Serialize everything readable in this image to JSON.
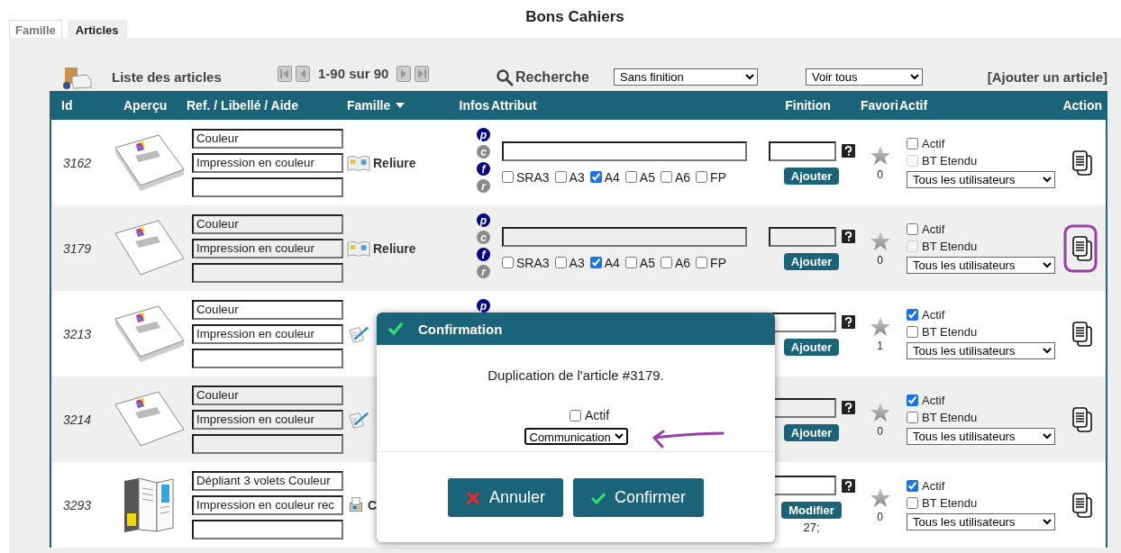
{
  "page_title": "Bons Cahiers",
  "tabs": [
    {
      "label": "Famille",
      "selected": false
    },
    {
      "label": "Articles",
      "selected": true
    }
  ],
  "toolbar": {
    "title": "Liste des articles",
    "pager": "1-90 sur 90",
    "search_label": "Recherche",
    "finition_filter": "Sans finition",
    "view_filter": "Voir tous",
    "add_link": "[Ajouter un article]"
  },
  "table": {
    "columns": [
      {
        "label": "Id",
        "sorted": false
      },
      {
        "label": "Aperçu",
        "sorted": false
      },
      {
        "label": "Ref. / Libellé / Aide",
        "sorted": false
      },
      {
        "label": "Famille",
        "sorted": true
      },
      {
        "label": "Infos",
        "sorted": false
      },
      {
        "label": "Attribut",
        "sorted": false
      },
      {
        "label": "Finition",
        "sorted": false
      },
      {
        "label": "Favori",
        "sorted": false
      },
      {
        "label": "Actif",
        "sorted": false
      },
      {
        "label": "Action",
        "sorted": false
      }
    ],
    "rows": [
      {
        "id": "3162",
        "preview": {
          "kind": "booklet"
        },
        "ref": "Couleur",
        "label": "Impression en couleur",
        "family_icon": {
          "kind": "book"
        },
        "family": "Reliure",
        "infos": [
          {
            "letter": "p",
            "color": "#00008b"
          },
          {
            "letter": "c",
            "color": "#8a8a8a"
          },
          {
            "letter": "f",
            "color": "#00008b"
          },
          {
            "letter": "r",
            "color": "#8a8a8a"
          }
        ],
        "formats": [
          {
            "label": "SRA3",
            "checked": false
          },
          {
            "label": "A3",
            "checked": false
          },
          {
            "label": "A4",
            "checked": true
          },
          {
            "label": "A5",
            "checked": false
          },
          {
            "label": "A6",
            "checked": false
          },
          {
            "label": "FP",
            "checked": false
          }
        ],
        "finition_button": "Ajouter",
        "favorites": "0",
        "actif_label": "Actif",
        "actif": false,
        "bt_label": "BT Etendu",
        "bt_etendu": false,
        "bt_disabled": true,
        "users": "Tous les utilisateurs",
        "highlighted": false
      },
      {
        "id": "3179",
        "preview": {
          "kind": "sheet"
        },
        "ref": "Couleur",
        "label": "Impression en couleur",
        "family_icon": {
          "kind": "book"
        },
        "family": "Reliure",
        "infos": [
          {
            "letter": "p",
            "color": "#00008b"
          },
          {
            "letter": "c",
            "color": "#8a8a8a"
          },
          {
            "letter": "f",
            "color": "#00008b"
          },
          {
            "letter": "r",
            "color": "#8a8a8a"
          }
        ],
        "formats": [
          {
            "label": "SRA3",
            "checked": false
          },
          {
            "label": "A3",
            "checked": false
          },
          {
            "label": "A4",
            "checked": true
          },
          {
            "label": "A5",
            "checked": false
          },
          {
            "label": "A6",
            "checked": false
          },
          {
            "label": "FP",
            "checked": false
          }
        ],
        "finition_button": "Ajouter",
        "favorites": "0",
        "actif_label": "Actif",
        "actif": false,
        "bt_label": "BT Etendu",
        "bt_etendu": false,
        "bt_disabled": true,
        "users": "Tous les utilisateurs",
        "highlighted": true
      },
      {
        "id": "3213",
        "preview": {
          "kind": "booklet"
        },
        "ref": "Couleur",
        "label": "Impression en couleur",
        "family_icon": {
          "kind": "pen"
        },
        "infos": [
          {
            "letter": "p",
            "color": "#00008b"
          }
        ],
        "finition_button": "Ajouter",
        "favorites": "1",
        "actif_label": "Actif",
        "actif": true,
        "bt_label": "BT Etendu",
        "bt_etendu": false,
        "bt_disabled": false,
        "users": "Tous les utilisateurs",
        "highlighted": false
      },
      {
        "id": "3214",
        "preview": {
          "kind": "sheet"
        },
        "ref": "Couleur",
        "label": "Impression en couleur",
        "family_icon": {
          "kind": "pen"
        },
        "finition_button": "Ajouter",
        "favorites": "0",
        "actif_label": "Actif",
        "actif": true,
        "bt_label": "BT Etendu",
        "bt_etendu": false,
        "bt_disabled": false,
        "users": "Tous les utilisateurs",
        "highlighted": false
      },
      {
        "id": "3293",
        "preview": {
          "kind": "brochure"
        },
        "ref": "Dépliant 3 volets Couleur",
        "label": "Impression en couleur rec",
        "family_icon": {
          "kind": "printer"
        },
        "family": "C",
        "finition_button": "Modifier",
        "finition_note": "27;",
        "favorites": "0",
        "actif_label": "Actif",
        "actif": true,
        "bt_label": "BT Etendu",
        "bt_etendu": false,
        "bt_disabled": false,
        "users": "Tous les utilisateurs",
        "highlighted": false
      }
    ]
  },
  "dialog": {
    "title": "Confirmation",
    "message": "Duplication de l'article #3179.",
    "actif_label": "Actif",
    "actif": false,
    "category": "Communication",
    "cancel": "Annuler",
    "confirm": "Confirmer"
  }
}
